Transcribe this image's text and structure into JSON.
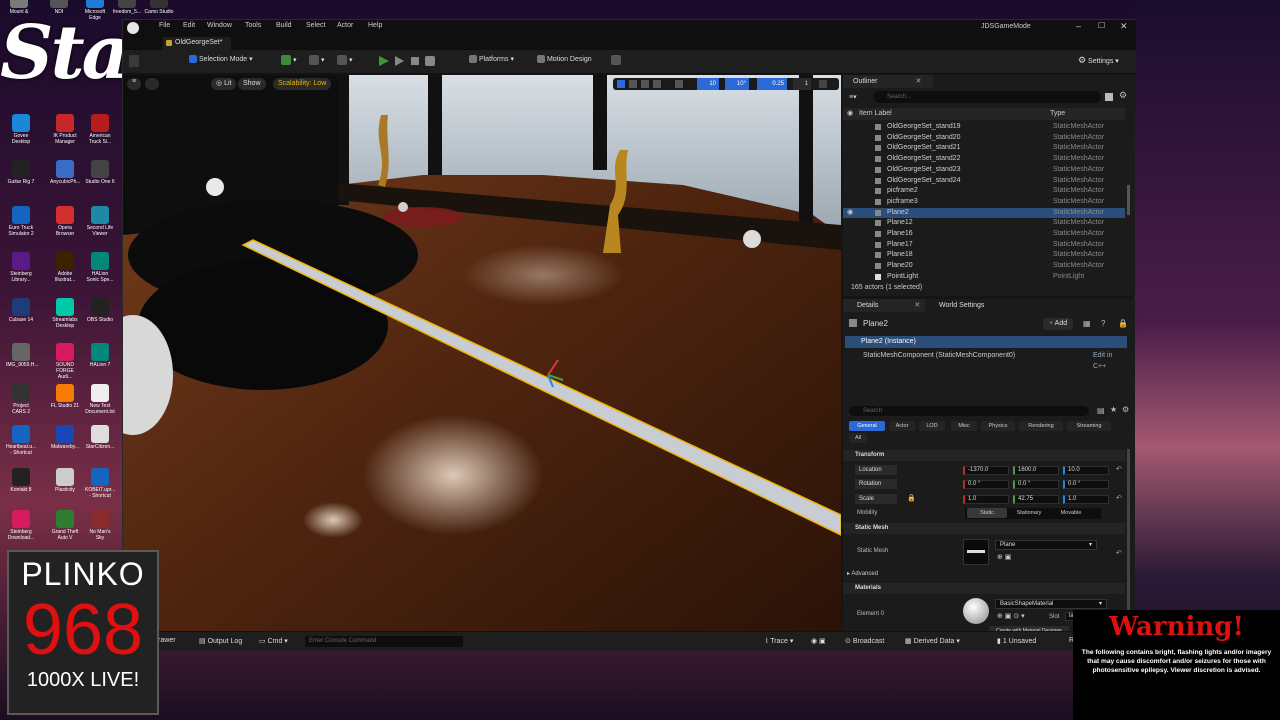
{
  "desktop": {
    "icons": [
      {
        "label": "Mount &",
        "color": "#7a7a7a"
      },
      {
        "label": "NDI",
        "color": "#555"
      },
      {
        "label": "Microsoft Edge",
        "color": "#1e7bd6"
      },
      {
        "label": "freedom_5...",
        "color": "#444"
      },
      {
        "label": "Camo Studio",
        "color": "#333"
      },
      {
        "label": "Govee Desktop",
        "color": "#1c86d8"
      },
      {
        "label": "IK Product Manager",
        "color": "#c62828"
      },
      {
        "label": "American Truck Si...",
        "color": "#b71c1c"
      },
      {
        "label": "Guitar Rig 7",
        "color": "#222"
      },
      {
        "label": "AnycubicPh...",
        "color": "#3a6cc7"
      },
      {
        "label": "Studio One 6",
        "color": "#444"
      },
      {
        "label": "Euro Truck Simulator 2",
        "color": "#1565c0"
      },
      {
        "label": "Opera Browser",
        "color": "#d32f2f"
      },
      {
        "label": "Second Life Viewer",
        "color": "#1e88a8"
      },
      {
        "label": "Steinberg Library...",
        "color": "#5a1a8a"
      },
      {
        "label": "Adobe Illustrat...",
        "color": "#3d2200"
      },
      {
        "label": "HALion Sonic Spe...",
        "color": "#00897b"
      },
      {
        "label": "Cubase 14",
        "color": "#1e3c78"
      },
      {
        "label": "Streamlabs Desktop",
        "color": "#00c9a7"
      },
      {
        "label": "OBS Studio",
        "color": "#222"
      },
      {
        "label": "IMG_9059.H...",
        "color": "#666"
      },
      {
        "label": "SOUND FORGE Audi...",
        "color": "#d81b60"
      },
      {
        "label": "HALion 7",
        "color": "#00897b"
      },
      {
        "label": "Project CARS 2",
        "color": "#333"
      },
      {
        "label": "FL Studio 21",
        "color": "#f57c00"
      },
      {
        "label": "New Text Document.txt",
        "color": "#eee"
      },
      {
        "label": "Heartbeat.u... - Shortcut",
        "color": "#1565c0"
      },
      {
        "label": "Malwareby...",
        "color": "#1a47b8"
      },
      {
        "label": "StarCitizen...",
        "color": "#ddd"
      },
      {
        "label": "Kontakt 8",
        "color": "#222"
      },
      {
        "label": "Plasticity",
        "color": "#ccc"
      },
      {
        "label": "KOBEIT.upr... - Shortcut",
        "color": "#1565c0"
      },
      {
        "label": "Steinberg Download...",
        "color": "#d81b60"
      },
      {
        "label": "Grand Theft Auto V",
        "color": "#2e7d32"
      },
      {
        "label": "No Man's Sky",
        "color": "#8a2a2a"
      }
    ]
  },
  "stream": {
    "logo": "Stake",
    "plinko_title": "PLINKO",
    "plinko_number": "968",
    "plinko_sub": "1000X LIVE!",
    "warning_title": "Warning!",
    "warning_text": "The following contains bright, flashing lights and/or imagery that may cause discomfort and/or seizures for those with photosensitive epilepsy. Viewer discretion is advised."
  },
  "editor": {
    "title": "JDSGameMode",
    "menus": [
      "File",
      "Edit",
      "Window",
      "Tools",
      "Build",
      "Select",
      "Actor",
      "Help"
    ],
    "level_tab": "OldGeorgeSet*",
    "toolbar": {
      "mode": "Selection Mode",
      "platforms": "Platforms",
      "motion_design": "Motion Design",
      "settings": "Settings"
    },
    "viewport": {
      "lit": "Lit",
      "show": "Show",
      "scalability": "Scalability: Low",
      "grid": "10",
      "angle": "10°",
      "scale": "0.25",
      "speed": "1"
    },
    "outliner": {
      "tab": "Outliner",
      "search_placeholder": "Search...",
      "col_label": "Item Label",
      "col_type": "Type",
      "rows": [
        {
          "name": "OldGeorgeSet_stand19",
          "type": "StaticMeshActor"
        },
        {
          "name": "OldGeorgeSet_stand20",
          "type": "StaticMeshActor"
        },
        {
          "name": "OldGeorgeSet_stand21",
          "type": "StaticMeshActor"
        },
        {
          "name": "OldGeorgeSet_stand22",
          "type": "StaticMeshActor"
        },
        {
          "name": "OldGeorgeSet_stand23",
          "type": "StaticMeshActor"
        },
        {
          "name": "OldGeorgeSet_stand24",
          "type": "StaticMeshActor"
        },
        {
          "name": "picframe2",
          "type": "StaticMeshActor"
        },
        {
          "name": "picframe3",
          "type": "StaticMeshActor"
        },
        {
          "name": "Plane2",
          "type": "StaticMeshActor"
        },
        {
          "name": "Plane12",
          "type": "StaticMeshActor"
        },
        {
          "name": "Plane16",
          "type": "StaticMeshActor"
        },
        {
          "name": "Plane17",
          "type": "StaticMeshActor"
        },
        {
          "name": "Plane18",
          "type": "StaticMeshActor"
        },
        {
          "name": "Plane20",
          "type": "StaticMeshActor"
        },
        {
          "name": "PointLight",
          "type": "PointLight"
        }
      ],
      "selected_index": 8,
      "footer": "165 actors (1 selected)"
    },
    "details": {
      "tab": "Details",
      "world_tab": "World Settings",
      "actor": "Plane2",
      "add": "Add",
      "instance": "Plane2 (Instance)",
      "component": "StaticMeshComponent (StaticMeshComponent0)",
      "edit_cpp": "Edit in C++",
      "search_placeholder": "Search",
      "categories": [
        "General",
        "Actor",
        "LOD",
        "Misc",
        "Physics",
        "Rendering",
        "Streaming",
        "All"
      ],
      "transform": "Transform",
      "location": {
        "label": "Location",
        "x": "-1370.0",
        "y": "1600.0",
        "z": "10.0"
      },
      "rotation": {
        "label": "Rotation",
        "x": "0.0 °",
        "y": "0.0 °",
        "z": "0.0 °"
      },
      "scale": {
        "label": "Scale",
        "x": "1.0",
        "y": "42.75",
        "z": "1.0"
      },
      "mobility": {
        "label": "Mobility",
        "opts": [
          "Static",
          "Stationary",
          "Movable"
        ]
      },
      "static_mesh_section": "Static Mesh",
      "static_mesh_label": "Static Mesh",
      "static_mesh_value": "Plane",
      "advanced": "Advanced",
      "materials": "Materials",
      "element0": "Element 0",
      "material_value": "BasicShapeMaterial",
      "slot_label": "Slot",
      "slot_value": "lambert1",
      "create_material": "Create with Material Designer"
    },
    "status": {
      "drawer": "Drawer",
      "output_log": "Output Log",
      "cmd": "Cmd",
      "console_placeholder": "Enter Console Command",
      "trace": "Trace",
      "broadcast": "Broadcast",
      "derived": "Derived Data",
      "unsaved": "1 Unsaved",
      "revision": "Re"
    }
  }
}
